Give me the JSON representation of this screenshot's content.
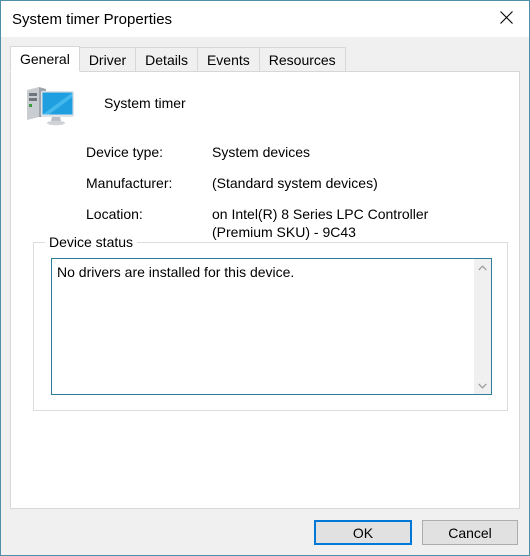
{
  "window": {
    "title": "System timer Properties",
    "close_icon": "close-icon"
  },
  "tabs": [
    {
      "label": "General",
      "selected": true
    },
    {
      "label": "Driver",
      "selected": false
    },
    {
      "label": "Details",
      "selected": false
    },
    {
      "label": "Events",
      "selected": false
    },
    {
      "label": "Resources",
      "selected": false
    }
  ],
  "general": {
    "device_icon": "computer-device-icon",
    "device_name": "System timer",
    "properties": [
      {
        "label": "Device type:",
        "value": "System devices"
      },
      {
        "label": "Manufacturer:",
        "value": "(Standard system devices)"
      },
      {
        "label": "Location:",
        "value": "on Intel(R) 8 Series LPC Controller (Premium SKU) - 9C43"
      }
    ],
    "status_group_label": "Device status",
    "status_text": "No drivers are installed for this device.",
    "scroll_up_icon": "chevron-up-icon",
    "scroll_down_icon": "chevron-down-icon"
  },
  "footer": {
    "ok_label": "OK",
    "cancel_label": "Cancel"
  },
  "colors": {
    "window_border": "#4f8faa",
    "accent_focus": "#0078d7",
    "field_border": "#2d7c9b",
    "dialog_background": "#f0f0f0"
  }
}
